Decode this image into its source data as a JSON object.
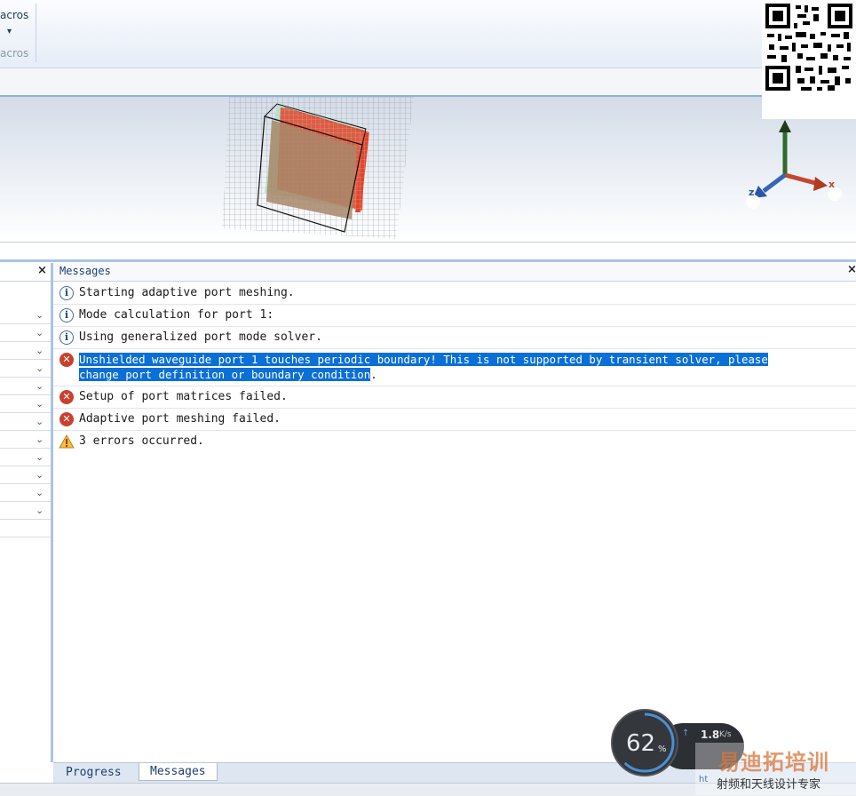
{
  "ribbon": {
    "macros_label": "acros",
    "macros_group": "acros",
    "dropdown_glyph": "▾"
  },
  "viewport": {
    "axes": {
      "x": "x",
      "y": "y",
      "z": "z"
    }
  },
  "left_panel": {
    "close_glyph": "×",
    "rows": 12,
    "chevron_glyph": "⌄"
  },
  "messages_panel": {
    "title": "Messages",
    "close_glyph": "×",
    "items": [
      {
        "type": "info",
        "icon": "info-icon",
        "text": "Starting adaptive port meshing."
      },
      {
        "type": "info",
        "icon": "info-icon",
        "text": "Mode calculation for port 1:"
      },
      {
        "type": "info",
        "icon": "info-icon",
        "text": "Using generalized port mode solver."
      },
      {
        "type": "error",
        "icon": "error-icon",
        "text_line1": "Unshielded waveguide port 1 touches periodic boundary! This is not supported by transient solver, please",
        "text_line2_selected": "change port definition or boundary condition",
        "text_line2_rest": "."
      },
      {
        "type": "error",
        "icon": "error-icon",
        "text": "Setup of port matrices failed."
      },
      {
        "type": "error",
        "icon": "error-icon",
        "text": "Adaptive port meshing failed."
      },
      {
        "type": "warning",
        "icon": "warning-icon",
        "text": "3 errors occurred."
      }
    ]
  },
  "bottom_tabs": {
    "progress": "Progress",
    "messages": "Messages"
  },
  "speed_widget": {
    "percent": "62",
    "percent_sign": "%",
    "rate": "1.8",
    "rate_unit": "K/s"
  },
  "watermark": {
    "title": "易迪拓培训",
    "subtitle": "射频和天线设计专家",
    "url_fragment": "ht"
  },
  "colors": {
    "selection": "#0a6fd6",
    "error": "#c9402f",
    "accent_border": "#a9c4e4"
  }
}
